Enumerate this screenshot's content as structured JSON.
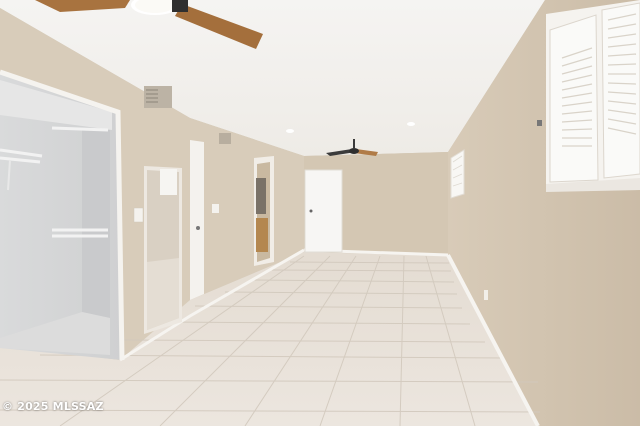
{
  "photo": {
    "watermark": "© 2025 MLSSAZ",
    "description_colors": {
      "ceiling": "#f3f1ee",
      "wall_left": "#d9cdbb",
      "wall_right": "#d4c6b3",
      "back_wall": "#d3c6b2",
      "floor": "#e9e3dc",
      "trim": "#f7f5f2",
      "fan_blade": "#a8733f"
    }
  }
}
